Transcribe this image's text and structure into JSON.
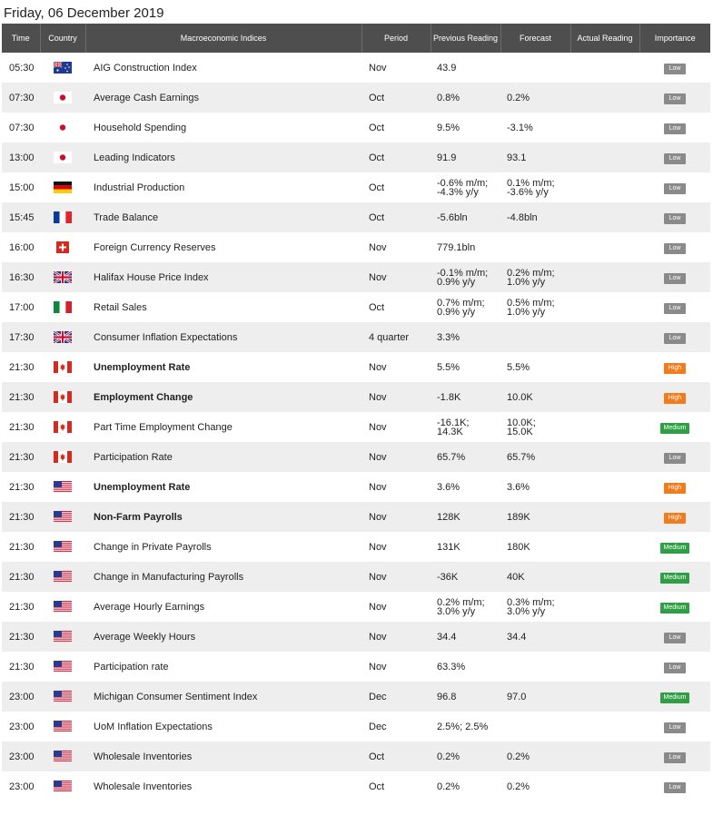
{
  "date_title": "Friday, 06 December 2019",
  "headers": {
    "time": "Time",
    "country": "Country",
    "indices": "Macroeconomic Indices",
    "period": "Period",
    "previous": "Previous Reading",
    "forecast": "Forecast",
    "actual": "Actual Reading",
    "importance": "Importance"
  },
  "rows": [
    {
      "time": "05:30",
      "country": "AU",
      "name": "AIG Construction Index",
      "bold": false,
      "period": "Nov",
      "prev": "43.9",
      "forecast": "",
      "actual": "",
      "importance": "Low"
    },
    {
      "time": "07:30",
      "country": "JP",
      "name": "Average Cash Earnings",
      "bold": false,
      "period": "Oct",
      "prev": "0.8%",
      "forecast": "0.2%",
      "actual": "",
      "importance": "Low"
    },
    {
      "time": "07:30",
      "country": "JP",
      "name": "Household Spending",
      "bold": false,
      "period": "Oct",
      "prev": "9.5%",
      "forecast": "-3.1%",
      "actual": "",
      "importance": "Low"
    },
    {
      "time": "13:00",
      "country": "JP",
      "name": "Leading Indicators",
      "bold": false,
      "period": "Oct",
      "prev": "91.9",
      "forecast": "93.1",
      "actual": "",
      "importance": "Low"
    },
    {
      "time": "15:00",
      "country": "DE",
      "name": "Industrial Production",
      "bold": false,
      "period": "Oct",
      "prev": "-0.6% m/m;\n-4.3% y/y",
      "forecast": "0.1% m/m;\n-3.6% y/y",
      "actual": "",
      "importance": "Low"
    },
    {
      "time": "15:45",
      "country": "FR",
      "name": "Trade Balance",
      "bold": false,
      "period": "Oct",
      "prev": "-5.6bln",
      "forecast": "-4.8bln",
      "actual": "",
      "importance": "Low"
    },
    {
      "time": "16:00",
      "country": "CH",
      "name": "Foreign Currency Reserves",
      "bold": false,
      "period": "Nov",
      "prev": "779.1bln",
      "forecast": "",
      "actual": "",
      "importance": "Low"
    },
    {
      "time": "16:30",
      "country": "GB",
      "name": "Halifax House Price Index",
      "bold": false,
      "period": "Nov",
      "prev": "-0.1% m/m;\n0.9% y/y",
      "forecast": "0.2% m/m;\n1.0% y/y",
      "actual": "",
      "importance": "Low"
    },
    {
      "time": "17:00",
      "country": "IT",
      "name": "Retail Sales",
      "bold": false,
      "period": "Oct",
      "prev": "0.7% m/m;\n0.9% y/y",
      "forecast": "0.5% m/m;\n1.0% y/y",
      "actual": "",
      "importance": "Low"
    },
    {
      "time": "17:30",
      "country": "GB",
      "name": "Consumer Inflation Expectations",
      "bold": false,
      "period": "4 quarter",
      "prev": "3.3%",
      "forecast": "",
      "actual": "",
      "importance": "Low"
    },
    {
      "time": "21:30",
      "country": "CA",
      "name": "Unemployment Rate",
      "bold": true,
      "period": "Nov",
      "prev": "5.5%",
      "forecast": "5.5%",
      "actual": "",
      "importance": "High"
    },
    {
      "time": "21:30",
      "country": "CA",
      "name": "Employment Change",
      "bold": true,
      "period": "Nov",
      "prev": "-1.8K",
      "forecast": "10.0K",
      "actual": "",
      "importance": "High"
    },
    {
      "time": "21:30",
      "country": "CA",
      "name": "Part Time Employment Change",
      "bold": false,
      "period": "Nov",
      "prev": "-16.1K;\n14.3K",
      "forecast": "10.0K;\n15.0K",
      "actual": "",
      "importance": "Medium"
    },
    {
      "time": "21:30",
      "country": "CA",
      "name": "Participation Rate",
      "bold": false,
      "period": "Nov",
      "prev": "65.7%",
      "forecast": "65.7%",
      "actual": "",
      "importance": "Low"
    },
    {
      "time": "21:30",
      "country": "US",
      "name": "Unemployment Rate",
      "bold": true,
      "period": "Nov",
      "prev": "3.6%",
      "forecast": "3.6%",
      "actual": "",
      "importance": "High"
    },
    {
      "time": "21:30",
      "country": "US",
      "name": "Non-Farm Payrolls",
      "bold": true,
      "period": "Nov",
      "prev": "128K",
      "forecast": "189K",
      "actual": "",
      "importance": "High"
    },
    {
      "time": "21:30",
      "country": "US",
      "name": "Change in Private Payrolls",
      "bold": false,
      "period": "Nov",
      "prev": "131K",
      "forecast": "180K",
      "actual": "",
      "importance": "Medium"
    },
    {
      "time": "21:30",
      "country": "US",
      "name": "Change in Manufacturing Payrolls",
      "bold": false,
      "period": "Nov",
      "prev": "-36K",
      "forecast": "40K",
      "actual": "",
      "importance": "Medium"
    },
    {
      "time": "21:30",
      "country": "US",
      "name": "Average Hourly Earnings",
      "bold": false,
      "period": "Nov",
      "prev": "0.2% m/m;\n3.0% y/y",
      "forecast": "0.3% m/m;\n3.0% y/y",
      "actual": "",
      "importance": "Medium"
    },
    {
      "time": "21:30",
      "country": "US",
      "name": "Average Weekly Hours",
      "bold": false,
      "period": "Nov",
      "prev": "34.4",
      "forecast": "34.4",
      "actual": "",
      "importance": "Low"
    },
    {
      "time": "21:30",
      "country": "US",
      "name": "Participation rate",
      "bold": false,
      "period": "Nov",
      "prev": "63.3%",
      "forecast": "",
      "actual": "",
      "importance": "Low"
    },
    {
      "time": "23:00",
      "country": "US",
      "name": "Michigan Consumer Sentiment Index",
      "bold": false,
      "period": "Dec",
      "prev": "96.8",
      "forecast": "97.0",
      "actual": "",
      "importance": "Medium"
    },
    {
      "time": "23:00",
      "country": "US",
      "name": "UoM Inflation Expectations",
      "bold": false,
      "period": "Dec",
      "prev": "2.5%; 2.5%",
      "forecast": "",
      "actual": "",
      "importance": "Low"
    },
    {
      "time": "23:00",
      "country": "US",
      "name": "Wholesale Inventories",
      "bold": false,
      "period": "Oct",
      "prev": "0.2%",
      "forecast": "0.2%",
      "actual": "",
      "importance": "Low"
    },
    {
      "time": "23:00",
      "country": "US",
      "name": "Wholesale Inventories",
      "bold": false,
      "period": "Oct",
      "prev": "0.2%",
      "forecast": "0.2%",
      "actual": "",
      "importance": "Low"
    }
  ],
  "colors": {
    "header_bg": "#4e4e4e",
    "row_alt_bg": "#eeeeee",
    "low": "#8a8a8a",
    "high": "#f07c1e",
    "medium": "#2f9e45"
  }
}
